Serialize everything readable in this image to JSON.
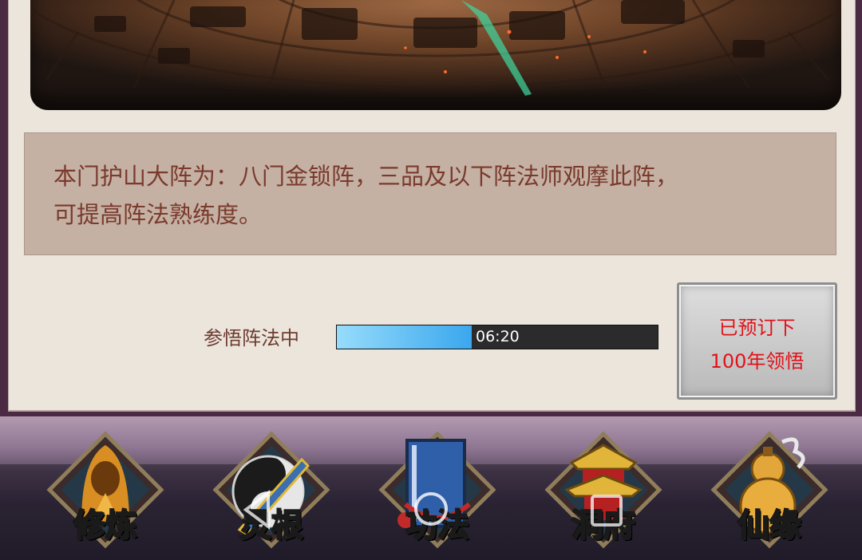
{
  "description": {
    "line1": "本门护山大阵为：八门金锁阵，三品及以下阵法师观摩此阵，",
    "line2": "可提高阵法熟练度。"
  },
  "progress": {
    "label": "参悟阵法中",
    "time": "06:20",
    "fraction": 0.42
  },
  "reserve_button": {
    "line1": "已预订下",
    "line2": "100年领悟"
  },
  "nav": {
    "items": [
      {
        "label": "修炼",
        "icon": "hooded-monk-icon"
      },
      {
        "label": "灵根",
        "icon": "taiji-sword-icon"
      },
      {
        "label": "功法",
        "icon": "scripture-book-icon"
      },
      {
        "label": "洞府",
        "icon": "pagoda-icon"
      },
      {
        "label": "仙缘",
        "icon": "gourd-icon"
      }
    ],
    "active_index": 2
  },
  "colors": {
    "desc_text": "#7a3a2c",
    "reserve_text": "#e0121a",
    "progress_fill": "#3aa7ee",
    "active_nav": "#f2c23a"
  }
}
